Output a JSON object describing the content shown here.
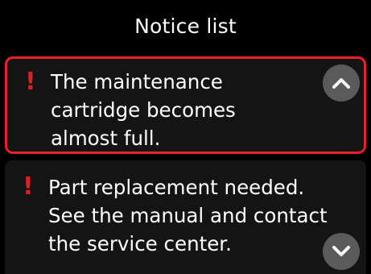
{
  "header": {
    "title": "Notice list"
  },
  "notices": [
    {
      "icon": "exclamation-icon",
      "text": "The maintenance\ncartridge becomes\nalmost full.",
      "selected": true
    },
    {
      "icon": "exclamation-icon",
      "text": "Part replacement needed.\nSee the manual and contact\nthe service center.",
      "selected": false
    }
  ],
  "controls": {
    "scroll_up_icon": "chevron-up-icon",
    "scroll_down_icon": "chevron-down-icon"
  },
  "colors": {
    "background": "#000000",
    "card": "#141414",
    "accent_red": "#e8202a",
    "button_gray": "#5a5a5a"
  }
}
